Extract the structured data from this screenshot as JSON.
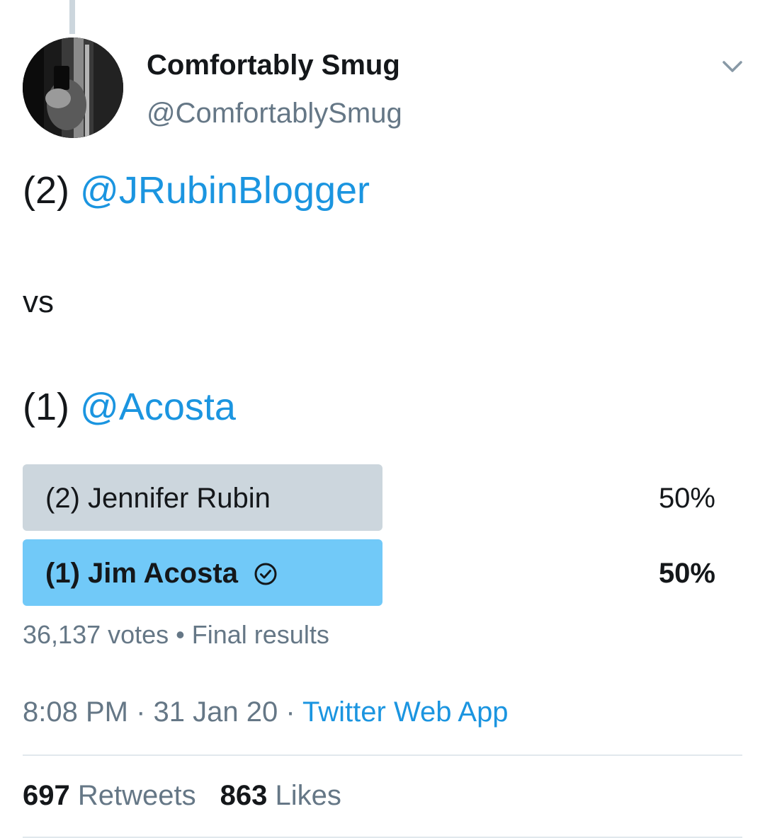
{
  "tweet": {
    "author": {
      "display_name": "Comfortably Smug",
      "handle": "@ComfortablySmug"
    },
    "body": {
      "line1_prefix": "(2) ",
      "line1_mention": "@JRubinBlogger",
      "line2": "vs",
      "line3_prefix": "(1) ",
      "line3_mention": "@Acosta"
    },
    "poll": {
      "options": [
        {
          "label": "(2) Jennifer Rubin",
          "percent_text": "50%",
          "share": 0.5
        },
        {
          "label": "(1) Jim Acosta",
          "percent_text": "50%",
          "share": 0.5,
          "winner": true
        }
      ],
      "votes": "36,137 votes",
      "separator": " • ",
      "status": "Final results"
    },
    "timestamp": {
      "time": "8:08 PM",
      "sep1": " · ",
      "date": "31 Jan 20",
      "sep2": " · ",
      "source": "Twitter Web App"
    },
    "stats": {
      "retweets_count": "697",
      "retweets_label": " Retweets",
      "likes_count": "863",
      "likes_label": " Likes"
    }
  },
  "colors": {
    "link": "#1b95e0",
    "muted": "#657786",
    "poll_bar": "#ccd6dd",
    "poll_winner_bar": "#71c9f8"
  },
  "icons": {
    "more": "chevron-down-icon",
    "winner": "check-circle-icon"
  }
}
